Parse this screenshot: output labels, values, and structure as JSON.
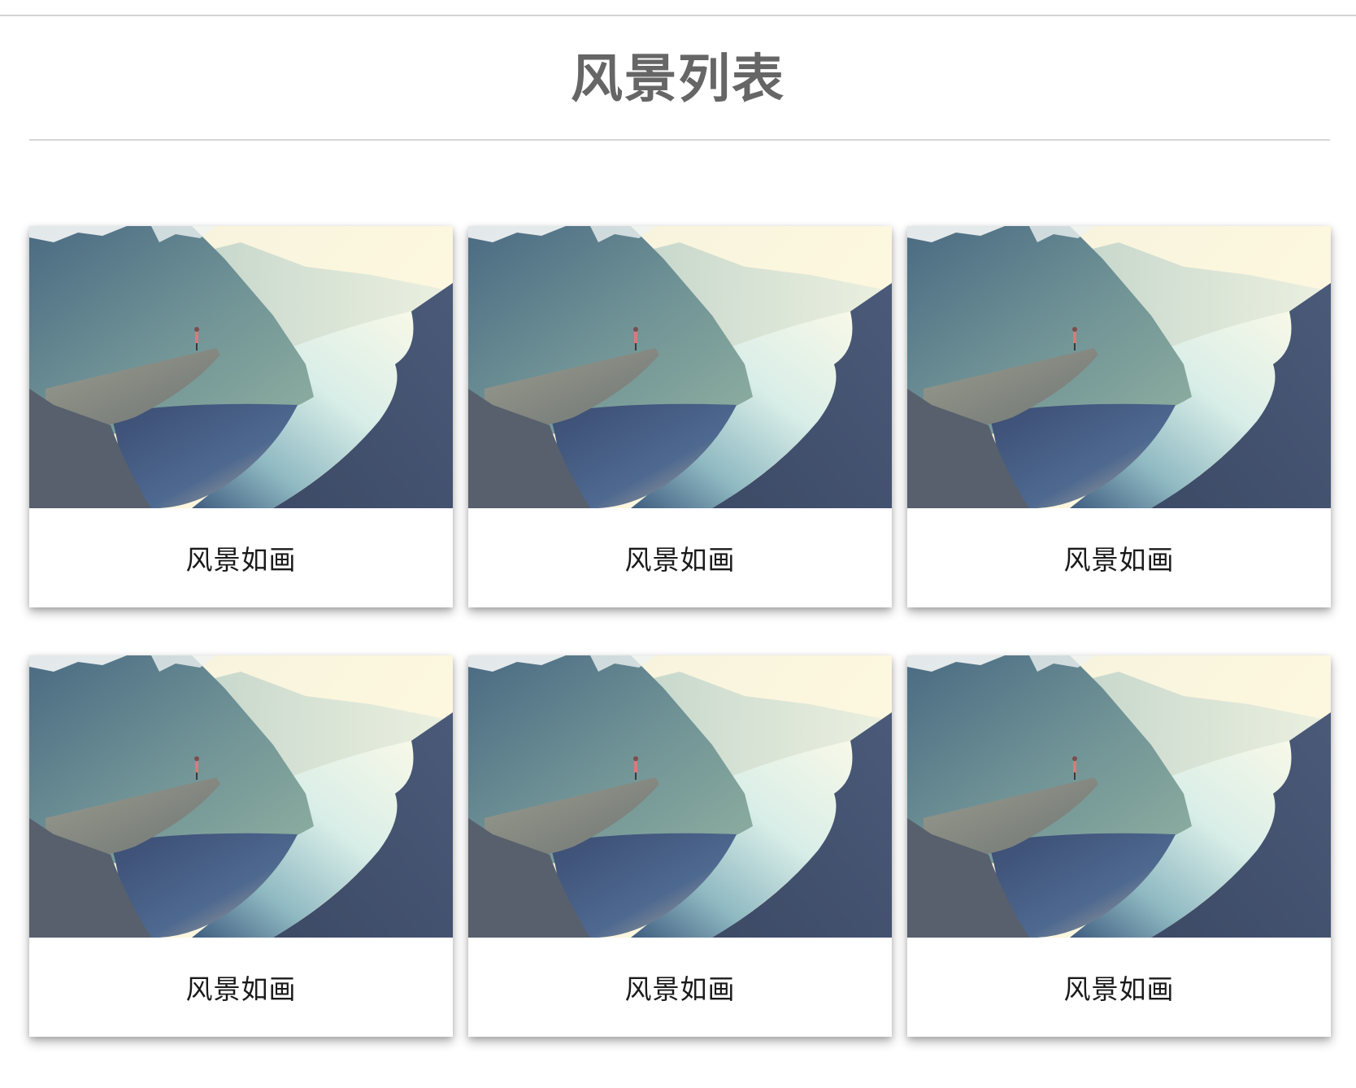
{
  "page": {
    "title": "风景列表"
  },
  "cards": [
    {
      "caption": "风景如画",
      "image": "fjord-cliff-photo"
    },
    {
      "caption": "风景如画",
      "image": "fjord-cliff-photo"
    },
    {
      "caption": "风景如画",
      "image": "fjord-cliff-photo"
    },
    {
      "caption": "风景如画",
      "image": "fjord-cliff-photo"
    },
    {
      "caption": "风景如画",
      "image": "fjord-cliff-photo"
    },
    {
      "caption": "风景如画",
      "image": "fjord-cliff-photo"
    }
  ],
  "colors": {
    "title": "#666666",
    "divider": "#d6d6d6",
    "caption": "#1a1a1a"
  }
}
